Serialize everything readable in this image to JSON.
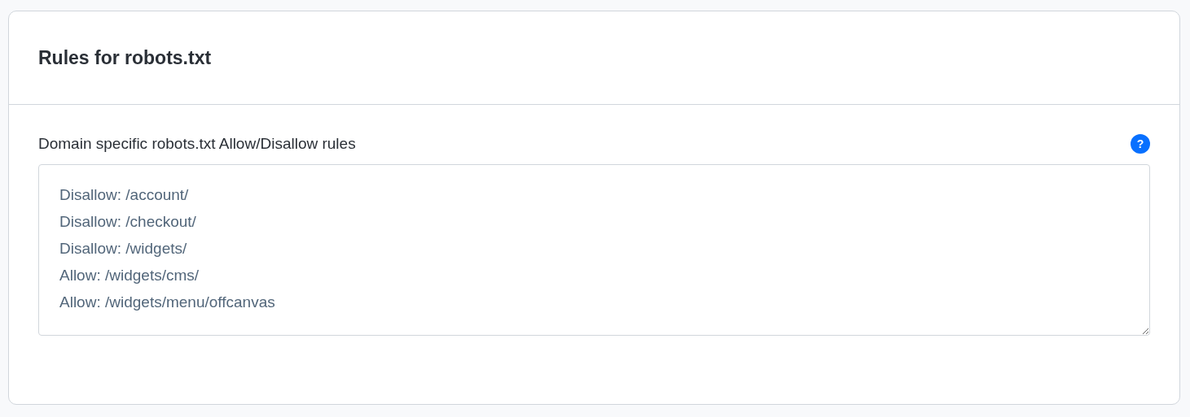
{
  "card": {
    "title": "Rules for robots.txt"
  },
  "field": {
    "label": "Domain specific robots.txt Allow/Disallow rules",
    "help": "?",
    "lines": [
      "Disallow: /account/",
      "Disallow: /checkout/",
      "Disallow: /widgets/",
      "Allow: /widgets/cms/",
      "Allow: /widgets/menu/offcanvas"
    ]
  }
}
